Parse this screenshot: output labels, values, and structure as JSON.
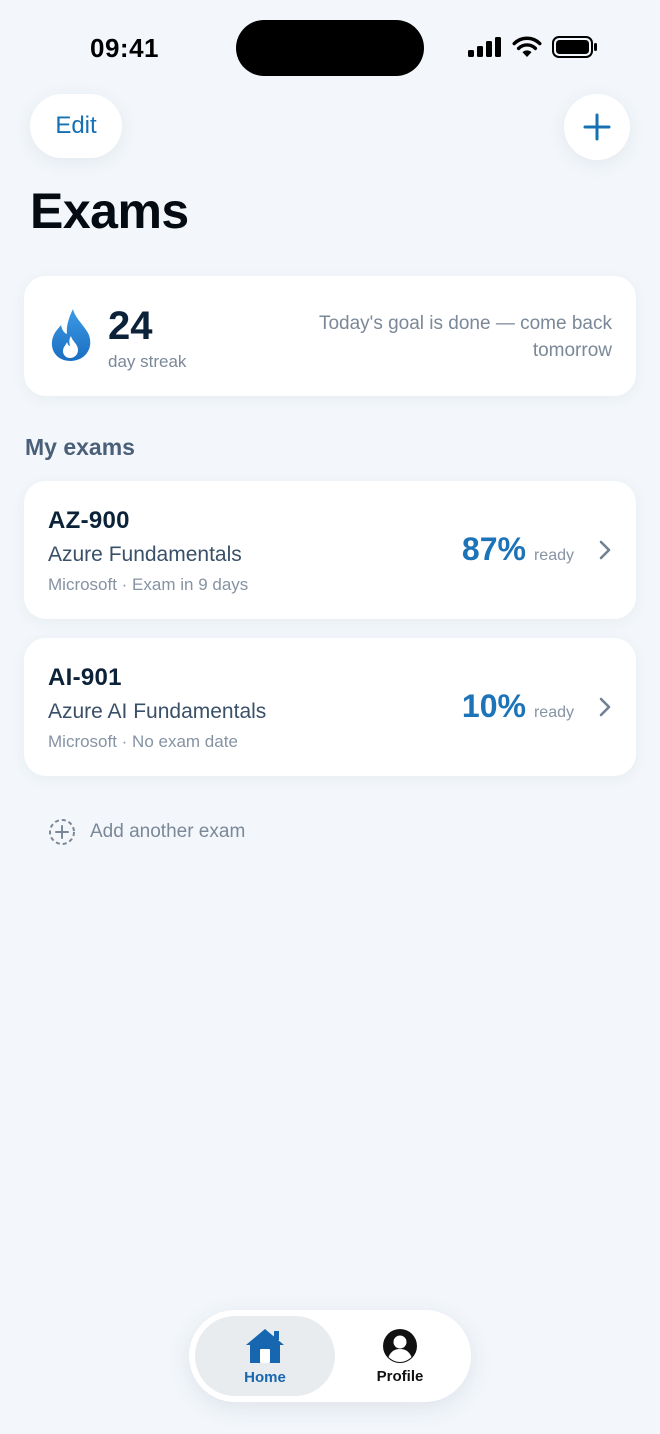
{
  "status_bar": {
    "time": "09:41"
  },
  "header": {
    "edit_label": "Edit",
    "title": "Exams"
  },
  "streak": {
    "count": "24",
    "unit": "day streak",
    "message": "Today's goal is done — come back tomorrow"
  },
  "my_exams": {
    "section_title": "My exams",
    "items": [
      {
        "code": "AZ-900",
        "name": "Azure Fundamentals",
        "meta": "Microsoft · Exam in 9 days",
        "percent": "87%",
        "ready_label": "ready"
      },
      {
        "code": "AI-901",
        "name": "Azure AI Fundamentals",
        "meta": "Microsoft · No exam date",
        "percent": "10%",
        "ready_label": "ready"
      }
    ],
    "add_label": "Add another exam"
  },
  "tabbar": {
    "tabs": [
      {
        "label": "Home",
        "icon": "home-icon",
        "active": true
      },
      {
        "label": "Profile",
        "icon": "person-circle-icon",
        "active": false
      }
    ]
  },
  "colors": {
    "accent": "#1670b3",
    "background": "#f3f7fb"
  }
}
